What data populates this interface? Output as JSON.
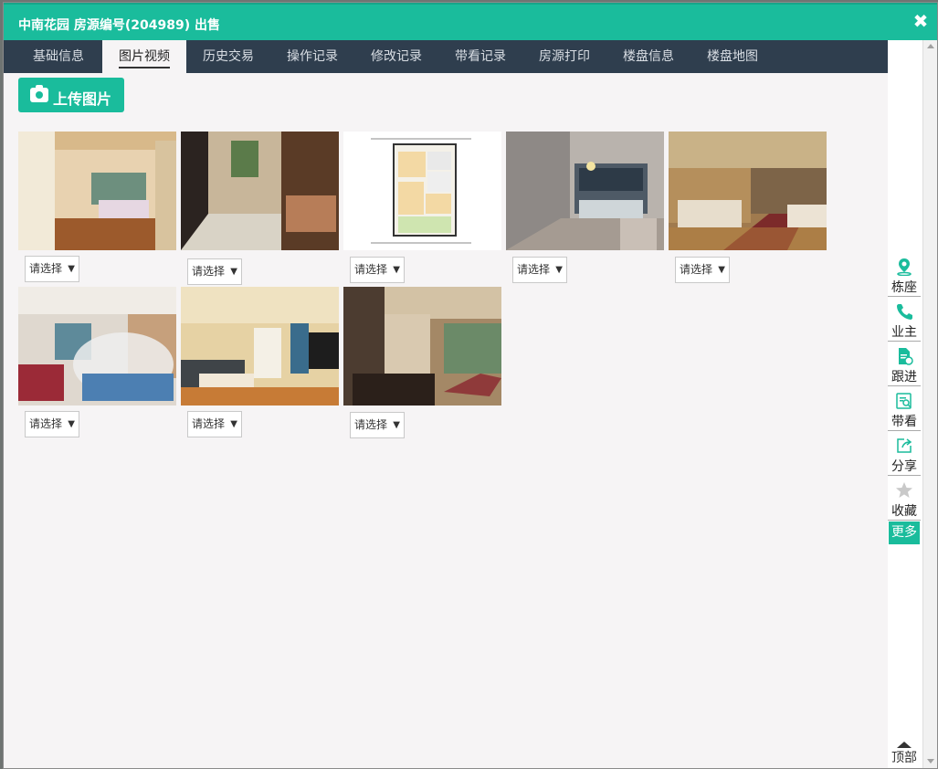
{
  "window": {
    "title": "中南花园 房源编号(204989) 出售",
    "close_icon": "close-icon"
  },
  "tabs": [
    {
      "label": "基础信息",
      "active": false
    },
    {
      "label": "图片视频",
      "active": true
    },
    {
      "label": "历史交易",
      "active": false
    },
    {
      "label": "操作记录",
      "active": false
    },
    {
      "label": "修改记录",
      "active": false
    },
    {
      "label": "带看记录",
      "active": false
    },
    {
      "label": "房源打印",
      "active": false
    },
    {
      "label": "楼盘信息",
      "active": false
    },
    {
      "label": "楼盘地图",
      "active": false
    }
  ],
  "toolbar": {
    "upload_label": "上传图片",
    "upload_icon": "camera-icon"
  },
  "photos": [
    {
      "subject": "bedroom",
      "select_label": "请选择"
    },
    {
      "subject": "hallway",
      "select_label": "请选择"
    },
    {
      "subject": "floor-plan",
      "select_label": "请选择"
    },
    {
      "subject": "living-room",
      "select_label": "请选择"
    },
    {
      "subject": "living-room",
      "select_label": "请选择"
    },
    {
      "subject": "bedroom",
      "select_label": "请选择"
    },
    {
      "subject": "living-room",
      "select_label": "请选择"
    },
    {
      "subject": "dining-room",
      "select_label": "请选择"
    }
  ],
  "sidebar": {
    "items": [
      {
        "label": "栋座",
        "icon": "location-pin-icon"
      },
      {
        "label": "业主",
        "icon": "phone-icon"
      },
      {
        "label": "跟进",
        "icon": "document-icon"
      },
      {
        "label": "带看",
        "icon": "search-document-icon"
      },
      {
        "label": "分享",
        "icon": "share-icon"
      },
      {
        "label": "收藏",
        "icon": "star-icon"
      }
    ],
    "more_label": "更多",
    "top_label": "顶部"
  },
  "colors": {
    "accent": "#1abc9c",
    "tabbar": "#2f3e4e"
  }
}
